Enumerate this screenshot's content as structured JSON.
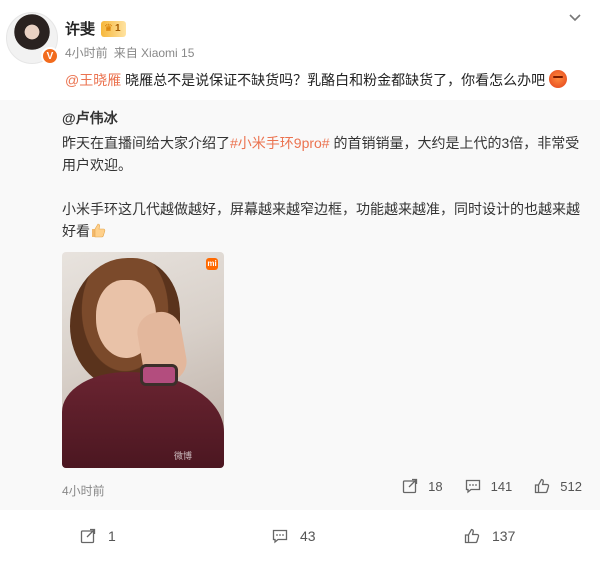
{
  "post": {
    "author": "许斐",
    "level": "1",
    "verified_glyph": "V",
    "time": "4小时前",
    "source": "来自 Xiaomi 15",
    "mention": "@王晓雁",
    "text": " 晓雁总不是说保证不缺货吗？乳酪白和粉金都缺货了，你看怎么办吧"
  },
  "repost": {
    "author": "@卢伟冰",
    "text_before_topic": "昨天在直播间给大家介绍了",
    "topic": "#小米手环9pro#",
    "text_after_topic": " 的首销销量，大约是上代的3倍，非常受用户欢迎。",
    "paragraph2": "小米手环这几代越做越好，屏幕越来越窄边框，功能越来越准，同时设计的也越来越好看",
    "photo_brand": "mi",
    "photo_watermark": "微博",
    "time": "4小时前",
    "actions": {
      "repost": "18",
      "comment": "141",
      "like": "512"
    }
  },
  "actions": {
    "repost": "1",
    "comment": "43",
    "like": "137"
  },
  "icons": {
    "more": "chevron-down-icon",
    "repost": "share-icon",
    "comment": "comment-icon",
    "like": "thumb-up-icon"
  }
}
